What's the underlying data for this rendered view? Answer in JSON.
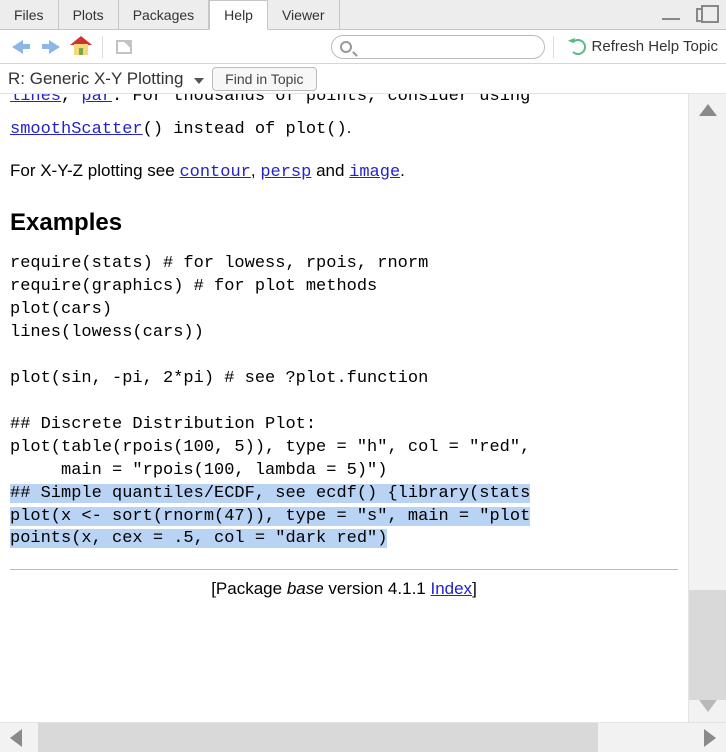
{
  "tabs": {
    "files": "Files",
    "plots": "Plots",
    "packages": "Packages",
    "help": "Help",
    "viewer": "Viewer"
  },
  "toolbar": {
    "refresh_label": "Refresh Help Topic",
    "search_placeholder": ""
  },
  "topic": {
    "title": "R: Generic X-Y Plotting",
    "find_label": "Find in Topic"
  },
  "body": {
    "partial_line_prefix_links": [
      "lines",
      "par"
    ],
    "partial_line_tail": ". For thousands of points, consider using",
    "line2_link": "smoothScatter",
    "line2_after": "() instead of ",
    "line2_mono": "plot()",
    "line2_period": ".",
    "xyz_prefix": "For X-Y-Z plotting see ",
    "xyz_links": [
      "contour",
      "persp",
      "image"
    ],
    "xyz_and": " and ",
    "examples_heading": "Examples",
    "code_block": "require(stats) # for lowess, rpois, rnorm\nrequire(graphics) # for plot methods\nplot(cars)\nlines(lowess(cars))\n\nplot(sin, -pi, 2*pi) # see ?plot.function\n\n## Discrete Distribution Plot:\nplot(table(rpois(100, 5)), type = \"h\", col = \"red\",\n     main = \"rpois(100, lambda = 5)\")\n",
    "selected_block": "## Simple quantiles/ECDF, see ecdf() {library(stats\nplot(x <- sort(rnorm(47)), type = \"s\", main = \"plot\npoints(x, cex = .5, col = \"dark red\")",
    "footer_prefix": "[Package ",
    "footer_pkg": "base",
    "footer_mid": " version 4.1.1 ",
    "footer_index": "Index",
    "footer_suffix": "]"
  }
}
